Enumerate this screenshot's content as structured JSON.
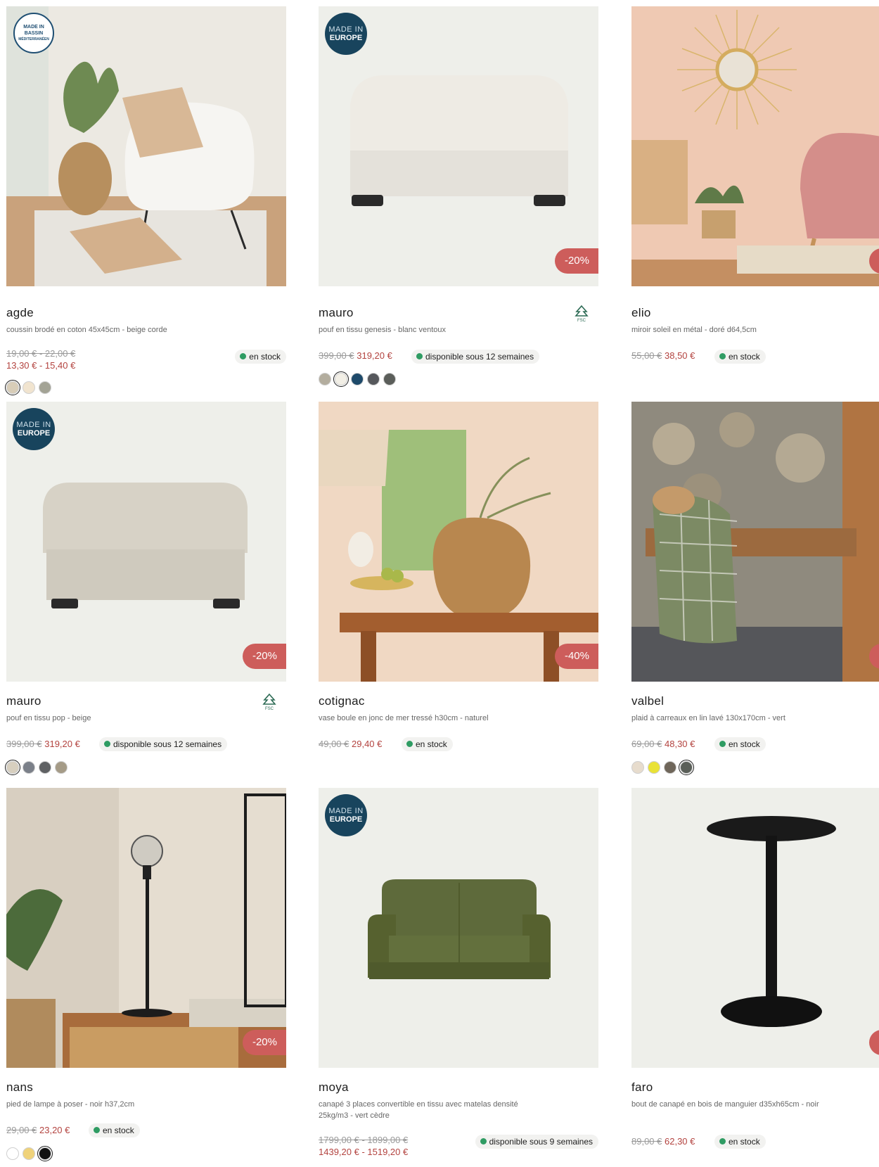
{
  "products": [
    {
      "name": "agde",
      "description": "coussin brodé en coton 45x45cm - beige corde",
      "old_price": "19,00 € - 22,00 €",
      "new_price": "13,30 € - 15,40 €",
      "stock": "en stock",
      "badge": "MADE IN BASSIN MÉDITERRANÉEN",
      "discount": "",
      "fsc": false,
      "swatches": [
        "#d8cdb8",
        "#f1e4cf",
        "#a3a395"
      ],
      "selected_swatch": 0
    },
    {
      "name": "mauro",
      "description": "pouf en tissu genesis - blanc ventoux",
      "old_price": "399,00 €",
      "new_price": "319,20 €",
      "stock": "disponible sous 12 semaines",
      "badge": "MADE IN EUROPE",
      "discount": "-20%",
      "fsc": true,
      "swatches": [
        "#b3ad9e",
        "#f2efe6",
        "#1e4a6a",
        "#56585c",
        "#5b5e5a"
      ],
      "selected_swatch": 1
    },
    {
      "name": "elio",
      "description": "miroir soleil en métal - doré d64,5cm",
      "old_price": "55,00 €",
      "new_price": "38,50 €",
      "stock": "en stock",
      "badge": "",
      "discount": "",
      "fsc": false,
      "swatches": [],
      "selected_swatch": -1
    },
    {
      "name": "mauro",
      "description": "pouf en tissu pop - beige",
      "old_price": "399,00 €",
      "new_price": "319,20 €",
      "stock": "disponible sous 12 semaines",
      "badge": "MADE IN EUROPE",
      "discount": "-20%",
      "fsc": true,
      "swatches": [
        "#d7cfbf",
        "#7b8089",
        "#5f6163",
        "#a59b87"
      ],
      "selected_swatch": 0
    },
    {
      "name": "cotignac",
      "description": "vase boule en jonc de mer tressé h30cm - naturel",
      "old_price": "49,00 €",
      "new_price": "29,40 €",
      "stock": "en stock",
      "badge": "",
      "discount": "-40%",
      "fsc": false,
      "swatches": [],
      "selected_swatch": -1
    },
    {
      "name": "valbel",
      "description": "plaid à carreaux en lin lavé 130x170cm - vert",
      "old_price": "69,00 €",
      "new_price": "48,30 €",
      "stock": "en stock",
      "badge": "",
      "discount": "",
      "fsc": false,
      "swatches": [
        "#e7dccd",
        "#e9e236",
        "#6f665a",
        "#5a5f58"
      ],
      "selected_swatch": 3
    },
    {
      "name": "nans",
      "description": "pied de lampe à poser - noir h37,2cm",
      "old_price": "29,00 €",
      "new_price": "23,20 €",
      "stock": "en stock",
      "badge": "",
      "discount": "-20%",
      "fsc": false,
      "swatches": [
        "#ffffff",
        "#efd27a",
        "#111111"
      ],
      "selected_swatch": 2
    },
    {
      "name": "moya",
      "description": "canapé 3 places convertible en tissu avec matelas densité 25kg/m3 - vert cèdre",
      "old_price": "1799,00 € - 1899,00 €",
      "new_price": "1439,20 € - 1519,20 €",
      "stock": "disponible sous 9 semaines",
      "badge": "MADE IN EUROPE",
      "discount": "",
      "fsc": false,
      "swatches": [],
      "selected_swatch": -1
    },
    {
      "name": "faro",
      "description": "bout de canapé en bois de manguier d35xh65cm - noir",
      "old_price": "89,00 €",
      "new_price": "62,30 €",
      "stock": "en stock",
      "badge": "",
      "discount": "",
      "fsc": false,
      "swatches": [],
      "selected_swatch": -1
    }
  ],
  "badge_text": {
    "europe_line1": "MADE IN",
    "europe_line2": "EUROPE",
    "bassin_line1": "MADE IN",
    "bassin_line2": "BASSIN",
    "bassin_line3": "MÉDITERRANÉEN"
  },
  "fsc_label": "FSC"
}
